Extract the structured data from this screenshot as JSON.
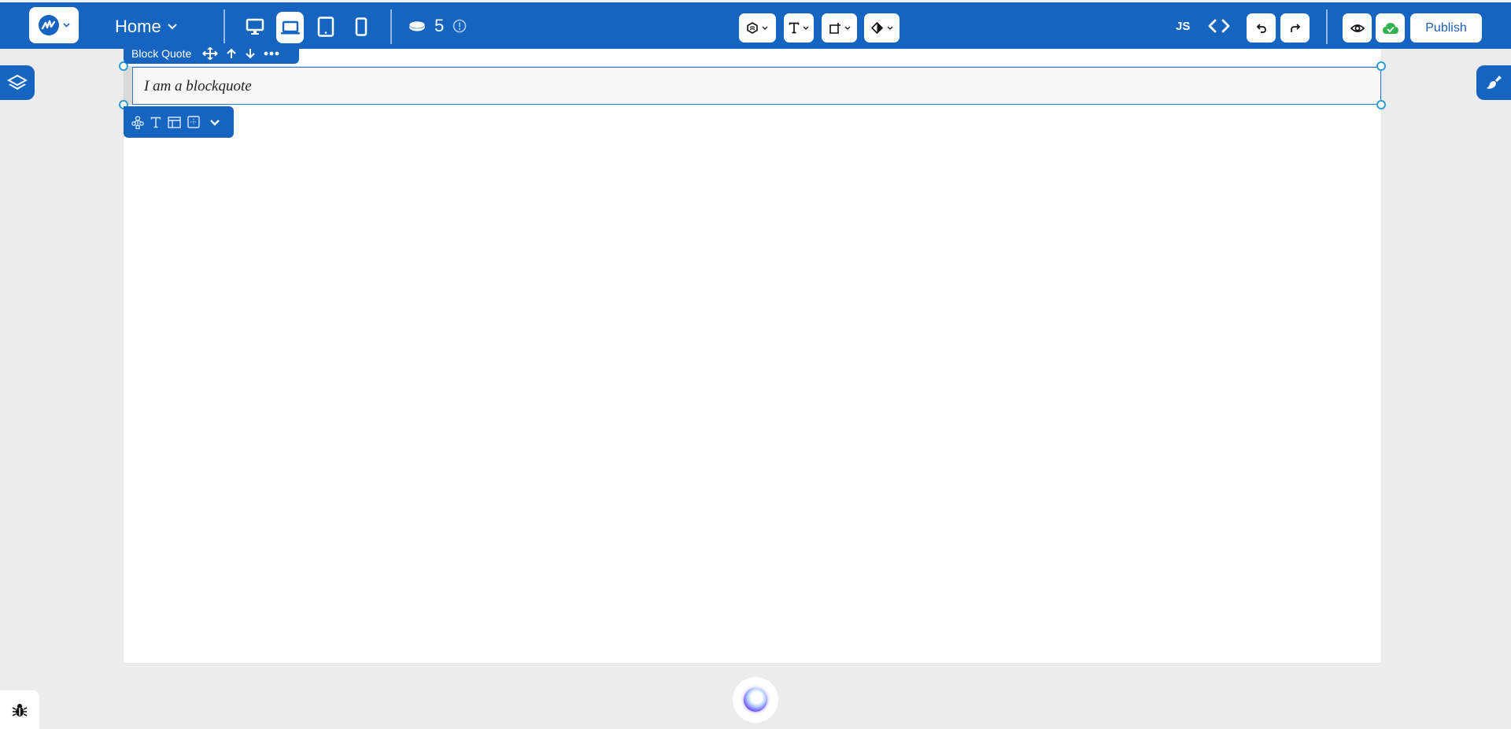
{
  "topbar": {
    "logo_icon": "brand-logo-icon",
    "page_selector": {
      "label": "Home"
    },
    "devices": [
      {
        "name": "desktop",
        "icon": "desktop-icon",
        "active": false
      },
      {
        "name": "laptop",
        "icon": "laptop-icon",
        "active": true
      },
      {
        "name": "tablet",
        "icon": "tablet-icon",
        "active": false
      },
      {
        "name": "mobile",
        "icon": "mobile-icon",
        "active": false
      }
    ],
    "credits": {
      "icon": "coin-icon",
      "value": "5",
      "info_icon": "info-icon"
    },
    "center_tools": [
      {
        "name": "component",
        "icon": "cube-icon"
      },
      {
        "name": "text",
        "icon": "text-icon"
      },
      {
        "name": "add-element",
        "icon": "add-shape-icon"
      },
      {
        "name": "theme",
        "icon": "contrast-icon"
      }
    ],
    "js_label": "JS",
    "code_icon": "code-icon",
    "undo_icon": "undo-icon",
    "redo_icon": "redo-icon",
    "preview_icon": "eye-icon",
    "saved_icon": "cloud-check-icon",
    "publish_label": "Publish"
  },
  "selection": {
    "element_label": "Block Quote",
    "actions": [
      "move-icon",
      "arrow-up-icon",
      "arrow-down-icon",
      "more-icon"
    ],
    "tools": [
      "hierarchy-icon",
      "text-icon",
      "layout-icon",
      "spacing-icon",
      "chevron-down-icon"
    ]
  },
  "canvas": {
    "blockquote_text": "I am a blockquote"
  },
  "left_panel_icon": "layers-icon",
  "right_panel_icon": "brush-icon",
  "ai_assistant_icon": "ai-orb-icon",
  "debug_icon": "bug-icon",
  "colors": {
    "brand": "#1565c0",
    "selection": "#2d73d6",
    "handle": "#2d9bd8",
    "saved": "#2fb34a"
  }
}
